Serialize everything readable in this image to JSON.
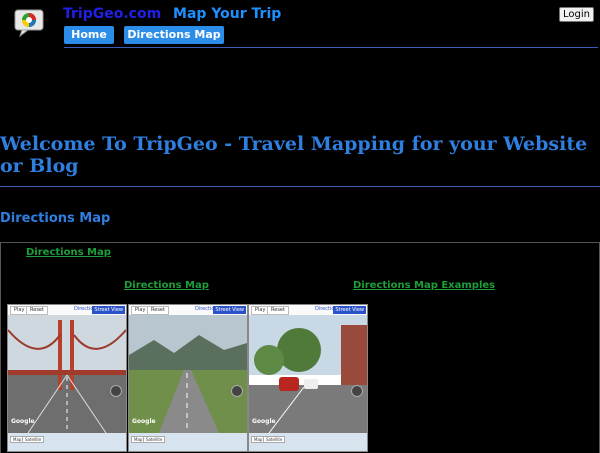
{
  "header": {
    "site_name": "TripGeo.com",
    "tagline": "Map Your Trip",
    "nav": [
      "Home",
      "Directions Map"
    ],
    "login_label": "Login"
  },
  "main": {
    "title": "Welcome To TripGeo - Travel Mapping for your Website or Blog",
    "subtitle": "Directions Map"
  },
  "panel": {
    "top_link": "Directions Map",
    "link_left": "Directions Map",
    "link_right": "Directions Map Examples"
  },
  "thumbnail_ui": {
    "play": "Play",
    "reset": "Reset",
    "directions": "Directions",
    "street_view": "Street View",
    "google": "Google",
    "map": "Map",
    "satellite": "Satellite"
  },
  "colors": {
    "background": "#000000",
    "accent": "#2f7fe0",
    "nav_button": "#2b8de8",
    "link_green": "#1e9e3a",
    "divider": "#3b5db8"
  },
  "icons": [
    "tripgeo-logo-icon"
  ]
}
